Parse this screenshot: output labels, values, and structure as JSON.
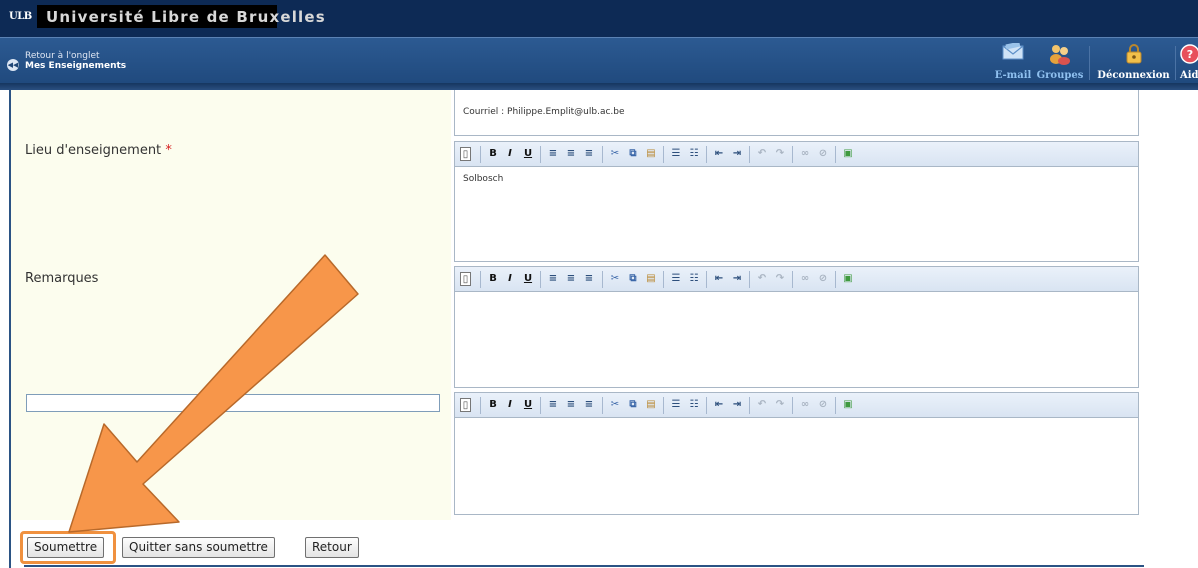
{
  "header": {
    "logo_text": "ULB",
    "site_title": "Université Libre de Bruxelles",
    "back_line1": "Retour à l'onglet",
    "back_line2": "Mes Enseignements",
    "nav": {
      "email": "E-mail",
      "groupes": "Groupes",
      "deconnexion": "Déconnexion",
      "aide": "Aide"
    }
  },
  "form": {
    "email_line": "Courriel : Philippe.Emplit@ulb.ac.be",
    "lieu_label": "Lieu d'enseignement",
    "required_mark": "*",
    "lieu_value": "Solbosch",
    "remarques_label": "Remarques",
    "remarques_value": "",
    "custom_title_value": "",
    "custom_value": ""
  },
  "toolbar_icons": [
    "new-document-icon",
    "bold-icon",
    "italic-icon",
    "underline-icon",
    "align-left-icon",
    "align-center-icon",
    "align-right-icon",
    "cut-icon",
    "copy-icon",
    "paste-icon",
    "bullet-list-icon",
    "numbered-list-icon",
    "outdent-icon",
    "indent-icon",
    "undo-icon",
    "redo-icon",
    "link-icon",
    "unlink-icon",
    "image-icon"
  ],
  "buttons": {
    "submit": "Soumettre",
    "quit": "Quitter sans soumettre",
    "back": "Retour"
  },
  "colors": {
    "header_dark": "#0d2a55",
    "navbar_blue": "#2c5a92",
    "label_column_bg": "#fcfdee",
    "annotation_orange": "#f7964a",
    "required_red": "#d62020"
  }
}
